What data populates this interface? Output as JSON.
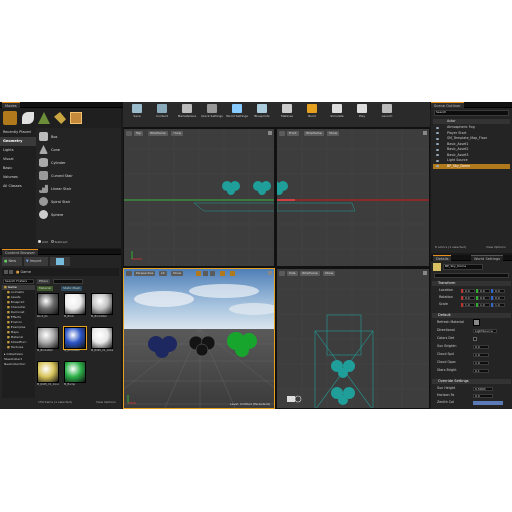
{
  "colors": {
    "accent": "#e58f1c",
    "selection": "#b0791c",
    "teal": "#1f9e9a",
    "green": "#22aa3a"
  },
  "modes_panel": {
    "tab": "Modes",
    "categories": [
      "Recently Placed",
      "Geometry",
      "Lights",
      "Visual",
      "Basic",
      "Volumes",
      "All Classes"
    ],
    "items": [
      "Box",
      "Cone",
      "Cylinder",
      "Curved Stair",
      "Linear Stair",
      "Spiral Stair",
      "Sphere"
    ],
    "footer_add": "Add",
    "footer_subtract": "Subtract"
  },
  "toolbar": {
    "buttons": [
      {
        "label": "Save",
        "icon": "save-icon"
      },
      {
        "label": "Content",
        "icon": "content-icon"
      },
      {
        "label": "Marketplace",
        "icon": "marketplace-icon"
      },
      {
        "label": "Quick Settings",
        "icon": "settings-icon"
      },
      {
        "label": "World Settings",
        "icon": "globe-icon"
      },
      {
        "label": "Blueprints",
        "icon": "blueprint-icon"
      },
      {
        "label": "Matinee",
        "icon": "matinee-icon"
      },
      {
        "label": "Build",
        "icon": "build-icon"
      },
      {
        "label": "Simulate",
        "icon": "play-icon"
      },
      {
        "label": "Play",
        "icon": "play-icon"
      },
      {
        "label": "Launch",
        "icon": "launch-icon"
      }
    ]
  },
  "content_browser": {
    "tab": "Content Browser",
    "new_label": "New",
    "import_label": "Import",
    "path": "Game",
    "search_placeholder": "Search Folders",
    "filters_label": "Filters",
    "filter_chips": [
      "Material",
      "Static Mesh"
    ],
    "folders": [
      "Game",
      "Animatio",
      "Assets",
      "Blueprint",
      "Character",
      "Demonst",
      "Effects",
      "Environ",
      "Examples",
      "Maps",
      "Material",
      "StreetFurn",
      "Textures"
    ],
    "collections_label": "Collections",
    "collections": [
      "SteelCollect",
      "NewCollection"
    ],
    "assets": [
      {
        "name": "Rock_01",
        "color": "#6a6a6a"
      },
      {
        "name": "M_Brick",
        "color": "#ececec"
      },
      {
        "name": "M_BrickWall",
        "color": "#c2c2c2"
      },
      {
        "name": "M_BrickWall",
        "color": "#a9a9a9"
      },
      {
        "name": "M_BrickWall",
        "color": "#2c55c6"
      },
      {
        "name": "M_ROPI_V1_Cobalt",
        "color": "#e8e8e8"
      },
      {
        "name": "M_ROPI_V1_Concrete",
        "color": "#d8c45a"
      },
      {
        "name": "M_Bump",
        "color": "#2db24a"
      }
    ],
    "status": "150 items (1 selected)",
    "view_options": "View Options"
  },
  "viewports": {
    "top_left": {
      "buttons": [
        "Top",
        "Wireframe",
        "Show"
      ]
    },
    "top_right": {
      "buttons": [
        "Front",
        "Wireframe",
        "Show"
      ]
    },
    "bottom_left": {
      "buttons": [
        "Perspective",
        "Lit",
        "Show"
      ],
      "level_label": "Level: Untitled (Persistent)"
    },
    "bottom_right": {
      "buttons": [
        "Side",
        "Wireframe",
        "Show"
      ]
    }
  },
  "scene_outliner": {
    "tab": "Scene Outliner",
    "search_placeholder": "Search",
    "header": "Actor",
    "rows": [
      "Atmospheric Fog",
      "Player Start",
      "SM_Template_Map_Floor",
      "Basic_Asset1",
      "Basic_Asset2",
      "Basic_Asset3",
      "Light Source",
      "BP_Sky_Dome"
    ],
    "selected_index": 7,
    "footer": "8 actors (1 selected)",
    "view_options": "View Options"
  },
  "details": {
    "tab": "Details",
    "tab2": "World Settings",
    "name_value": "BP_Sky_Dome",
    "sections": [
      "Transform",
      "Default",
      "Override Settings"
    ],
    "transform_rows": [
      {
        "label": "Location",
        "values": [
          "0.0",
          "0.0",
          "0.0"
        ]
      },
      {
        "label": "Rotation",
        "values": [
          "0.0",
          "0.0",
          "0.0"
        ]
      },
      {
        "label": "Scale",
        "values": [
          "1.0",
          "1.0",
          "1.0"
        ]
      }
    ],
    "default_rows": [
      {
        "label": "Refresh Material",
        "value": ""
      },
      {
        "label": "Directional",
        "value": "LightSource"
      },
      {
        "label": "Colors Det",
        "value": ""
      },
      {
        "label": "Sun Brightn",
        "value": "0.0"
      },
      {
        "label": "Cloud Spd",
        "value": "1.0"
      },
      {
        "label": "Cloud Opac",
        "value": "1.0"
      },
      {
        "label": "Stars Bright",
        "value": "0.1"
      }
    ],
    "override_rows": [
      {
        "label": "Sun Height",
        "value": "0.5000"
      },
      {
        "label": "Horizon Fa",
        "value": "0.0"
      },
      {
        "label": "Zenith Col",
        "value": ""
      }
    ]
  }
}
